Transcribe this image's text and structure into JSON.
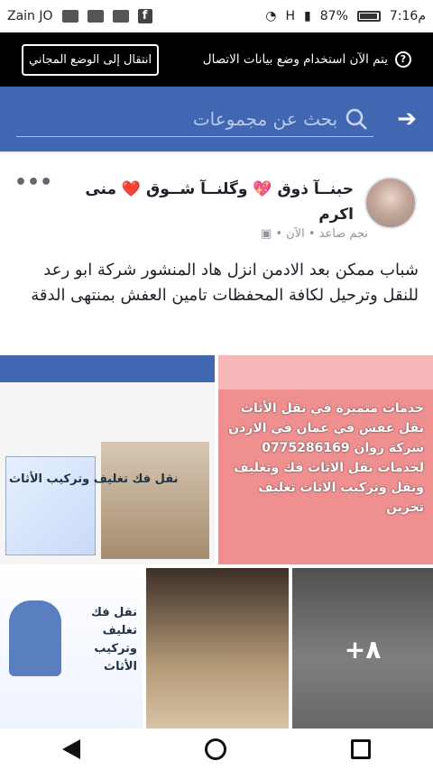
{
  "status_bar": {
    "carrier": "Zain JO",
    "network": "H",
    "battery": "87%",
    "time": "7:16م"
  },
  "data_notice": {
    "free_mode_button": "انتقال إلى الوضع المجاني",
    "message": "يتم الآن استخدام وضع بيانات الاتصال",
    "help_icon": "?"
  },
  "search": {
    "placeholder": "بحث عن مجموعات",
    "back_icon": "arrow-right-icon"
  },
  "post": {
    "author": "حبنــآ ذوق 💖 وگلنــآ شــوق ❤️ منى اكرم",
    "meta": "نجم صاعد • الآن •",
    "more": "•••",
    "text": "شباب ممكن بعد الادمن انزل هاد المنشور شركة ابو رعد للنقل وترحيل لكافة المحفظات  تامين العفش بمنتهى الدقة",
    "more_photos": "+٨"
  },
  "photo_captions": {
    "p1_title": "نقل فك تغليف وتركيب الأثاث",
    "p2_text": "خدمات متميزة في نقل الأثاث نقل عفش في عمان في الاردن شركة روان 0775286169 لخدمات نقل الاثاث فك وتغليف ونقل وتركيب الاثاث تغليف تخزين",
    "p3_title": "نقل فك تغليف وتركيب الأثاث"
  }
}
